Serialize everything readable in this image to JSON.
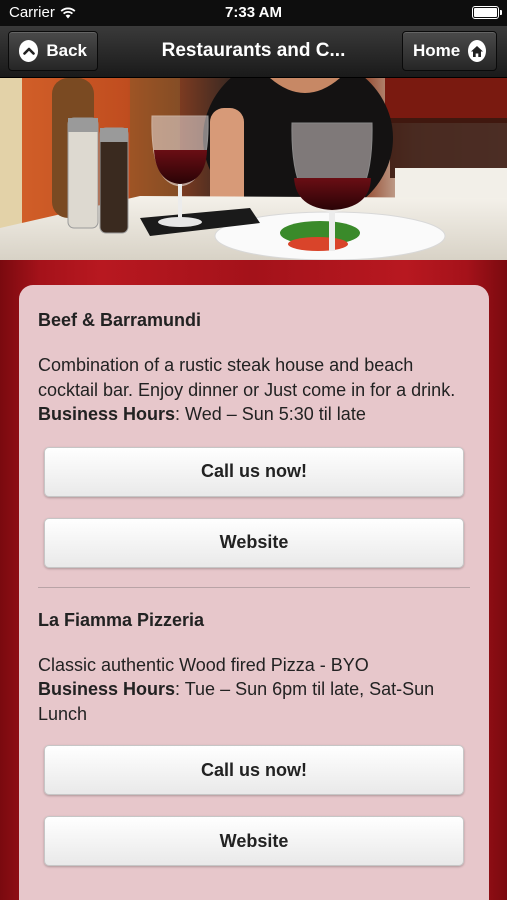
{
  "status_bar": {
    "carrier": "Carrier",
    "time": "7:33 AM"
  },
  "nav": {
    "back_label": "Back",
    "title": "Restaurants and C...",
    "home_label": "Home"
  },
  "listings": [
    {
      "name": "Beef & Barramundi",
      "description": "Combination of a rustic steak house and beach cocktail bar. Enjoy dinner or Just come in for a drink.",
      "hours_label": "Business Hours",
      "hours_value": ": Wed – Sun 5:30 til late",
      "call_label": "Call us now!",
      "website_label": "Website"
    },
    {
      "name": "La Fiamma Pizzeria",
      "description": "Classic authentic Wood fired Pizza - BYO",
      "hours_label": "Business Hours",
      "hours_value": ": Tue – Sun 6pm til late, Sat-Sun Lunch",
      "call_label": "Call us now!",
      "website_label": "Website"
    }
  ],
  "colors": {
    "background_red": "#b81820",
    "panel": "#e7c7cb",
    "nav_dark": "#1a1a1a"
  },
  "icons": [
    "wifi-icon",
    "battery-icon",
    "chevron-up-icon",
    "home-icon"
  ]
}
